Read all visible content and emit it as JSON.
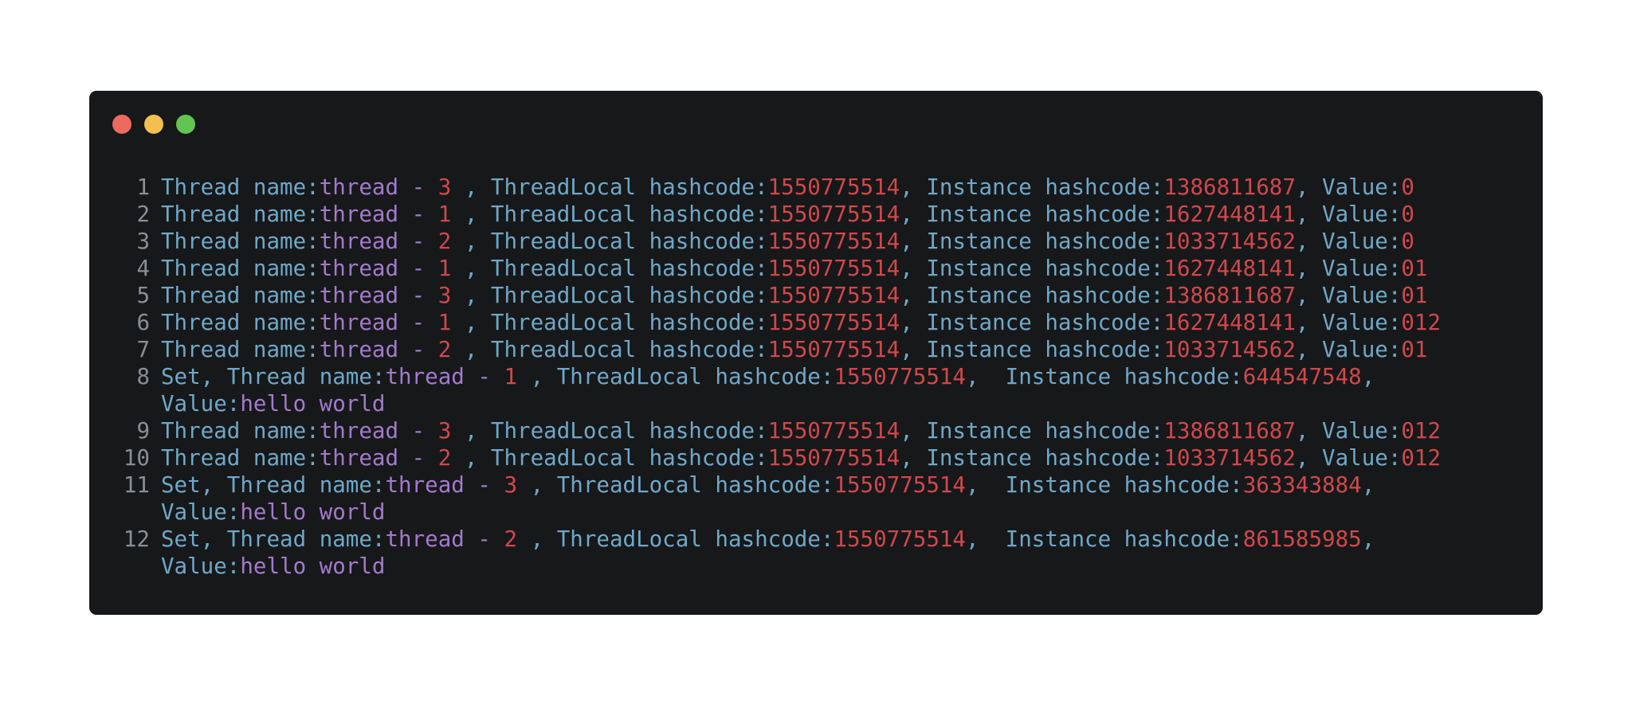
{
  "window": {
    "controls": [
      "close",
      "minimize",
      "maximize"
    ]
  },
  "code": {
    "lines": [
      {
        "no": "1",
        "prefix": "",
        "thread": "3",
        "tl": "1550775514",
        "inst": "1386811687",
        "value": "0",
        "set": false
      },
      {
        "no": "2",
        "prefix": "",
        "thread": "1",
        "tl": "1550775514",
        "inst": "1627448141",
        "value": "0",
        "set": false
      },
      {
        "no": "3",
        "prefix": "",
        "thread": "2",
        "tl": "1550775514",
        "inst": "1033714562",
        "value": "0",
        "set": false
      },
      {
        "no": "4",
        "prefix": "",
        "thread": "1",
        "tl": "1550775514",
        "inst": "1627448141",
        "value": "01",
        "set": false
      },
      {
        "no": "5",
        "prefix": "",
        "thread": "3",
        "tl": "1550775514",
        "inst": "1386811687",
        "value": "01",
        "set": false
      },
      {
        "no": "6",
        "prefix": "",
        "thread": "1",
        "tl": "1550775514",
        "inst": "1627448141",
        "value": "012",
        "set": false
      },
      {
        "no": "7",
        "prefix": "",
        "thread": "2",
        "tl": "1550775514",
        "inst": "1033714562",
        "value": "01",
        "set": false
      },
      {
        "no": "8",
        "prefix": "Set, ",
        "thread": "1",
        "tl": "1550775514",
        "inst": "644547548",
        "value": "hello world",
        "set": true
      },
      {
        "no": "9",
        "prefix": "",
        "thread": "3",
        "tl": "1550775514",
        "inst": "1386811687",
        "value": "012",
        "set": false
      },
      {
        "no": "10",
        "prefix": "",
        "thread": "2",
        "tl": "1550775514",
        "inst": "1033714562",
        "value": "012",
        "set": false
      },
      {
        "no": "11",
        "prefix": "Set, ",
        "thread": "3",
        "tl": "1550775514",
        "inst": "363343884",
        "value": "hello world",
        "set": true
      },
      {
        "no": "12",
        "prefix": "Set, ",
        "thread": "2",
        "tl": "1550775514",
        "inst": "861585985",
        "value": "hello world",
        "set": true
      }
    ],
    "labels": {
      "thread_name": "Thread name:",
      "thread_word": "thread - ",
      "threadlocal": " , ThreadLocal hashcode:",
      "instance": ", Instance hashcode:",
      "instance_set": ",  Instance hashcode:",
      "value": ", Value:",
      "value_wrap": ",",
      "value_label": "Value:"
    }
  },
  "colors": {
    "background": "#17181a",
    "keyword": "#6fa8c8",
    "string": "#a37acc",
    "number": "#d0484b",
    "line_number": "#8a8f94"
  }
}
